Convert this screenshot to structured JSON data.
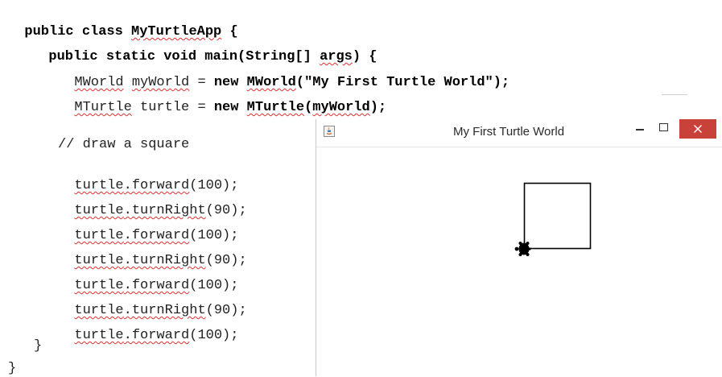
{
  "code": {
    "line1": {
      "kw": "public class ",
      "name": "MyTurtleApp",
      "rest": " {"
    },
    "line2": {
      "text": "public static void main(String[] ",
      "args": "args",
      "rest": ") {"
    },
    "line3": {
      "type": "MWorld",
      "var": " ",
      "varname": "myWorld",
      "mid": " = ",
      "kw_new": "new ",
      "ctor": "MWorld",
      "ctor_args": "(\"My First Turtle World\");"
    },
    "line4": {
      "type": "MTurtle",
      "mid": " turtle = ",
      "kw_new": "new ",
      "ctor": "MTurtle",
      "open": "(",
      "arg": "myWorld",
      "close": ");"
    },
    "comment": "// draw a square",
    "calls": [
      {
        "obj": "turtle",
        "method": ".forward",
        "args": "(100);"
      },
      {
        "obj": "turtle",
        "method": ".turnRight",
        "args": "(90);"
      },
      {
        "obj": "turtle",
        "method": ".forward",
        "args": "(100);"
      },
      {
        "obj": "turtle",
        "method": ".turnRight",
        "args": "(90);"
      },
      {
        "obj": "turtle",
        "method": ".forward",
        "args": "(100);"
      },
      {
        "obj": "turtle",
        "method": ".turnRight",
        "args": "(90);"
      },
      {
        "obj": "turtle",
        "method": ".forward",
        "args": "(100);"
      }
    ],
    "close_method": "}",
    "close_class": "}"
  },
  "window": {
    "title": "My First Turtle World",
    "icon": "java-app-icon",
    "controls": {
      "minimize_icon": "minimize-icon",
      "maximize_icon": "maximize-icon",
      "close_icon": "close-icon",
      "close_color": "#c9423a"
    }
  },
  "colors": {
    "squiggle": "#e0312e",
    "text": "#222222",
    "keyword": "#000000"
  }
}
